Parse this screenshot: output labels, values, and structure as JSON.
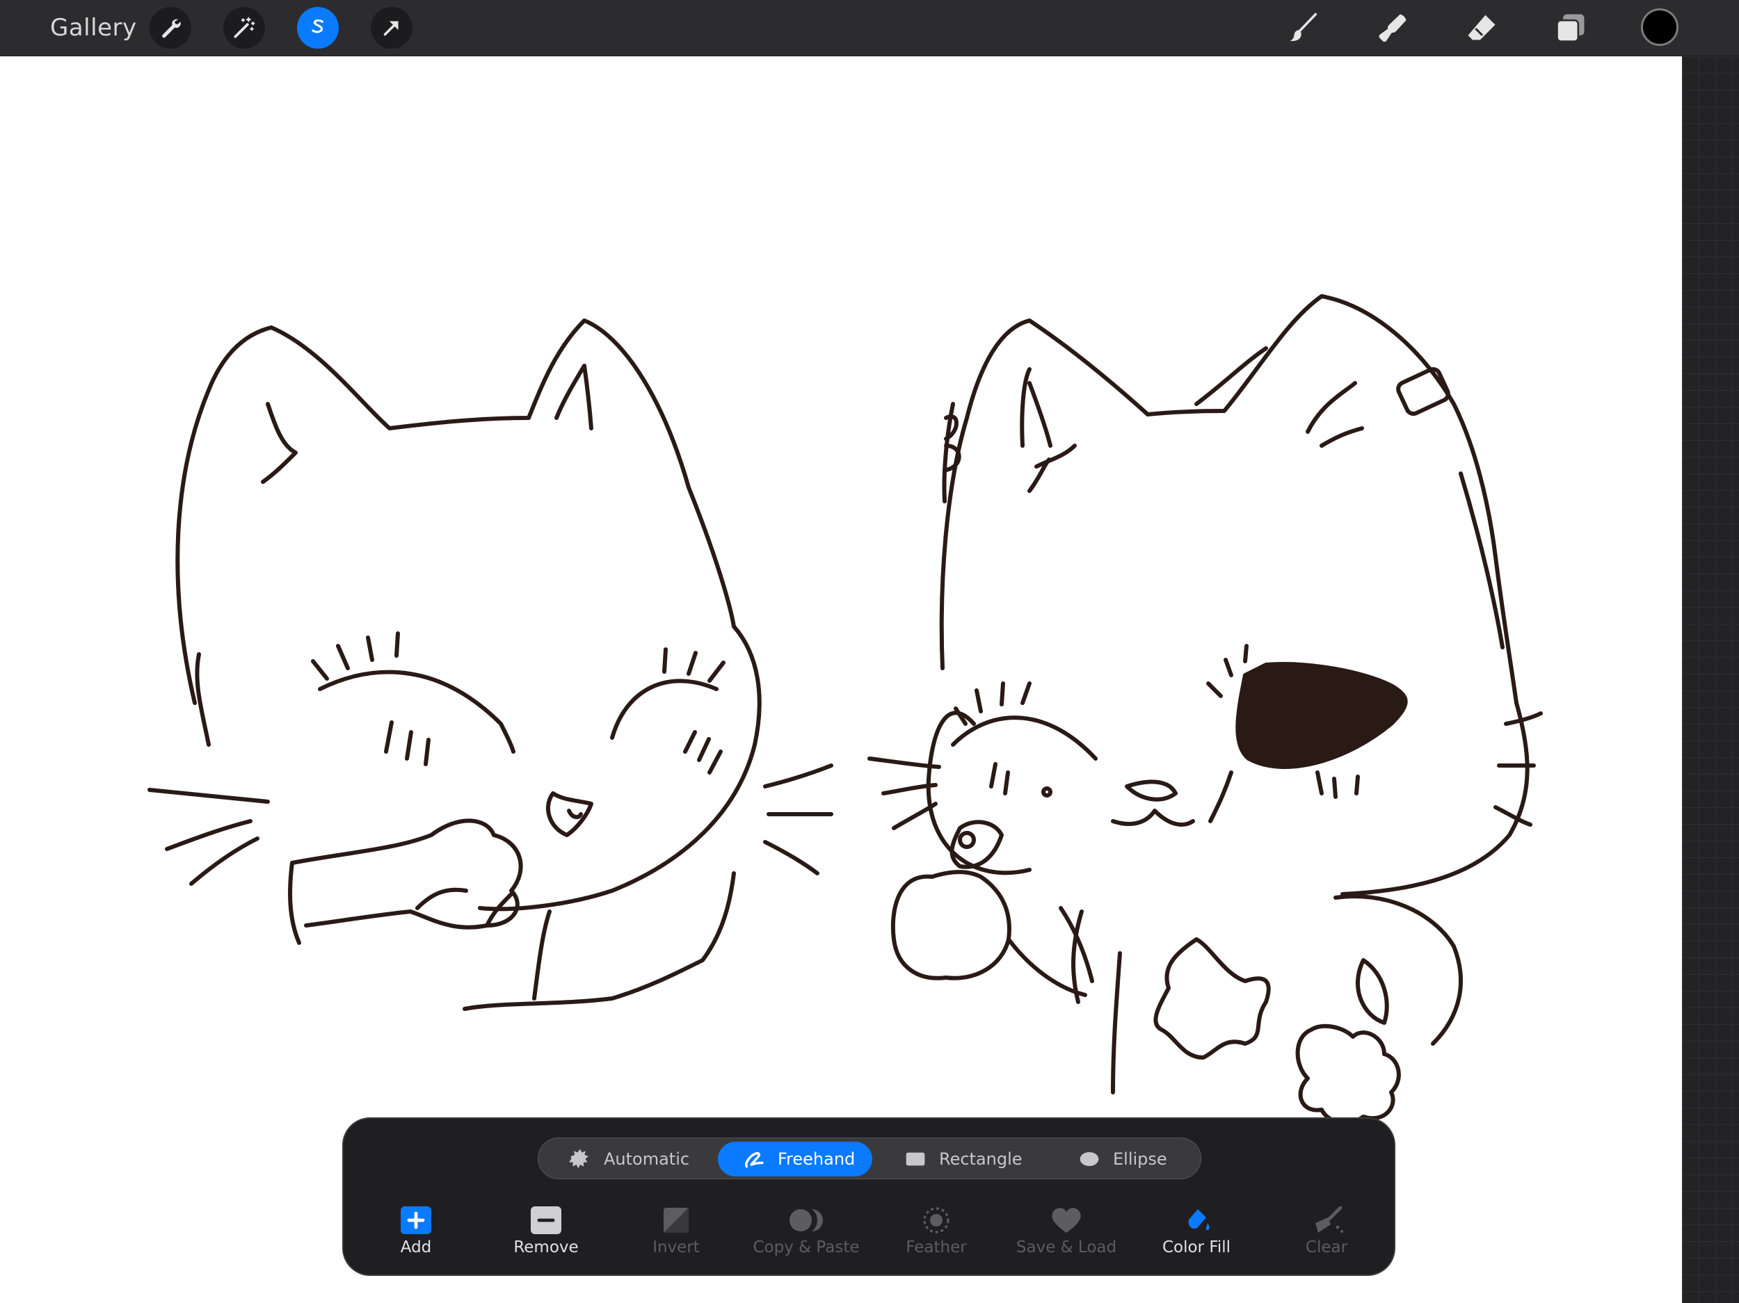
{
  "topbar": {
    "gallery_label": "Gallery",
    "left_tools": [
      {
        "name": "actions",
        "icon": "wrench-icon",
        "active": false
      },
      {
        "name": "adjustments",
        "icon": "magic-wand-icon",
        "active": false
      },
      {
        "name": "selection",
        "icon": "selection-s-icon",
        "active": true
      },
      {
        "name": "transform",
        "icon": "arrow-cursor-icon",
        "active": false
      }
    ],
    "right_tools": [
      {
        "name": "paint",
        "icon": "brush-icon"
      },
      {
        "name": "smudge",
        "icon": "smudge-finger-icon"
      },
      {
        "name": "erase",
        "icon": "eraser-icon"
      },
      {
        "name": "layers",
        "icon": "layers-icon"
      }
    ],
    "current_color": "#000000",
    "active_color": "#0a7aff"
  },
  "selection_panel": {
    "modes": [
      {
        "label": "Automatic",
        "icon": "automatic-burst-icon",
        "active": false
      },
      {
        "label": "Freehand",
        "icon": "freehand-lasso-icon",
        "active": true
      },
      {
        "label": "Rectangle",
        "icon": "rectangle-icon",
        "active": false
      },
      {
        "label": "Ellipse",
        "icon": "ellipse-icon",
        "active": false
      }
    ],
    "actions": [
      {
        "label": "Add",
        "icon": "plus-square-icon",
        "enabled": true
      },
      {
        "label": "Remove",
        "icon": "minus-square-icon",
        "enabled": true
      },
      {
        "label": "Invert",
        "icon": "invert-icon",
        "enabled": false
      },
      {
        "label": "Copy & Paste",
        "icon": "copy-paste-icon",
        "enabled": false
      },
      {
        "label": "Feather",
        "icon": "feather-icon",
        "enabled": false
      },
      {
        "label": "Save & Load",
        "icon": "heart-icon",
        "enabled": false
      },
      {
        "label": "Color Fill",
        "icon": "color-fill-icon",
        "enabled": true
      },
      {
        "label": "Clear",
        "icon": "clear-brush-icon",
        "enabled": false
      }
    ]
  },
  "canvas": {
    "stroke_color": "#2a1a16"
  }
}
